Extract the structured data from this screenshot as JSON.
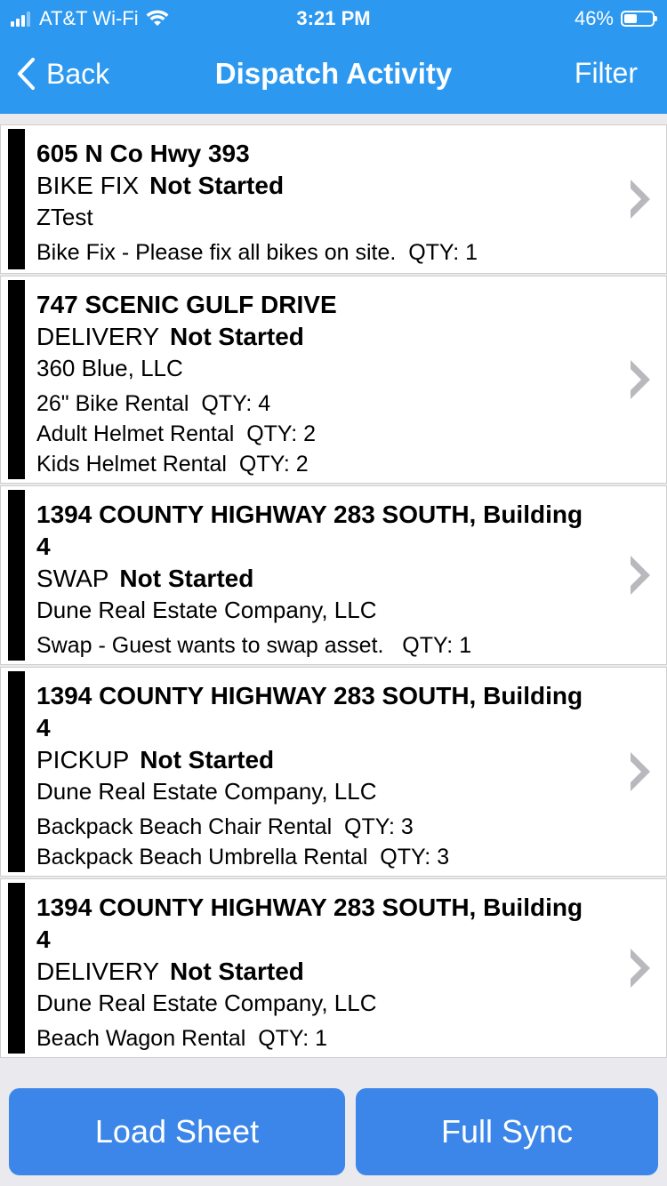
{
  "status_bar": {
    "carrier": "AT&T Wi-Fi",
    "time": "3:21 PM",
    "battery": "46%",
    "battery_level": 0.46
  },
  "nav": {
    "back_label": "Back",
    "title": "Dispatch Activity",
    "filter_label": "Filter"
  },
  "dispatches": [
    {
      "address": "605 N Co Hwy 393",
      "type": "BIKE FIX",
      "status": "Not Started",
      "company": "ZTest",
      "items": [
        "Bike Fix - Please fix all bikes on site.  QTY: 1"
      ]
    },
    {
      "address": "747 SCENIC GULF DRIVE",
      "type": "DELIVERY",
      "status": "Not Started",
      "company": "360 Blue, LLC",
      "items": [
        "26\" Bike Rental  QTY: 4",
        "Adult Helmet Rental  QTY: 2",
        "Kids Helmet Rental  QTY: 2"
      ]
    },
    {
      "address": "1394 COUNTY HIGHWAY 283 SOUTH, Building 4",
      "type": "SWAP",
      "status": "Not Started",
      "company": "Dune Real Estate Company, LLC",
      "items": [
        "Swap - Guest wants to swap asset.   QTY: 1"
      ]
    },
    {
      "address": "1394 COUNTY HIGHWAY 283 SOUTH, Building 4",
      "type": "PICKUP",
      "status": "Not Started",
      "company": "Dune Real Estate Company, LLC",
      "items": [
        "Backpack Beach Chair Rental  QTY: 3",
        "Backpack Beach Umbrella Rental  QTY: 3"
      ]
    },
    {
      "address": "1394 COUNTY HIGHWAY 283 SOUTH, Building 4",
      "type": "DELIVERY",
      "status": "Not Started",
      "company": "Dune Real Estate Company, LLC",
      "items": [
        "Beach Wagon Rental  QTY: 1"
      ]
    }
  ],
  "footer": {
    "load_sheet_label": "Load Sheet",
    "full_sync_label": "Full Sync"
  },
  "colors": {
    "nav_bg": "#2c98f0",
    "button_bg": "#3b86e8",
    "status_bar_stripe": "#000000"
  }
}
